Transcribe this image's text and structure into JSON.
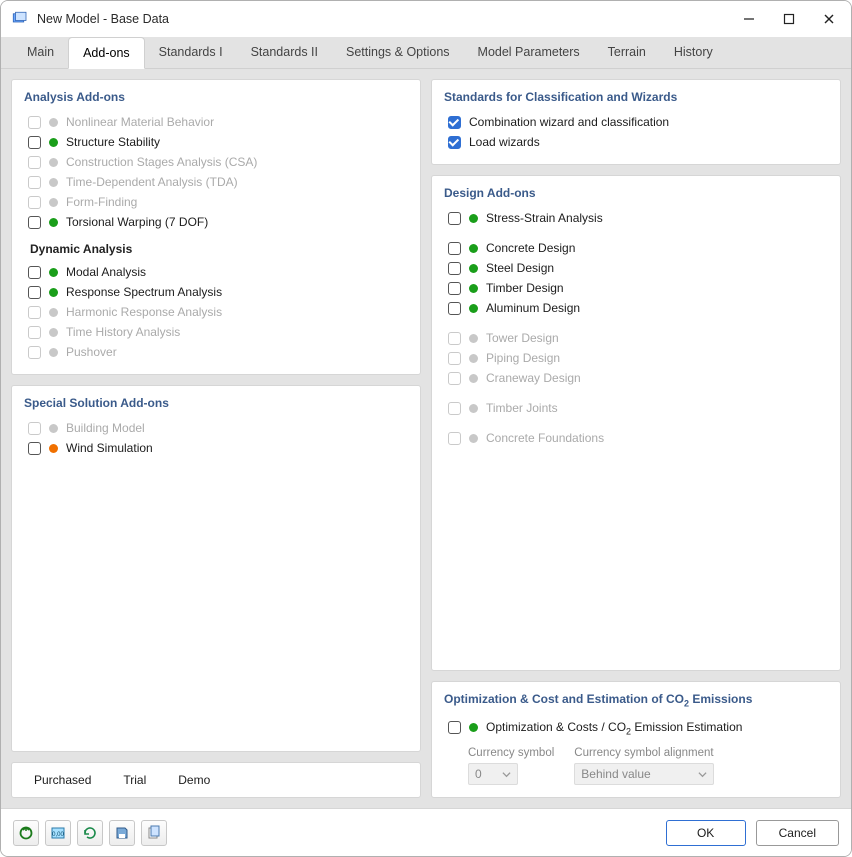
{
  "window": {
    "title": "New Model - Base Data"
  },
  "tabs": {
    "items": [
      {
        "label": "Main"
      },
      {
        "label": "Add-ons"
      },
      {
        "label": "Standards I"
      },
      {
        "label": "Standards II"
      },
      {
        "label": "Settings & Options"
      },
      {
        "label": "Model Parameters"
      },
      {
        "label": "Terrain"
      },
      {
        "label": "History"
      }
    ],
    "active": 1
  },
  "panels": {
    "analysis": {
      "title": "Analysis Add-ons",
      "items": [
        {
          "label": "Nonlinear Material Behavior",
          "dot": "grey",
          "disabled": true
        },
        {
          "label": "Structure Stability",
          "dot": "green"
        },
        {
          "label": "Construction Stages Analysis (CSA)",
          "dot": "grey",
          "disabled": true
        },
        {
          "label": "Time-Dependent Analysis (TDA)",
          "dot": "grey",
          "disabled": true
        },
        {
          "label": "Form-Finding",
          "dot": "grey",
          "disabled": true
        },
        {
          "label": "Torsional Warping (7 DOF)",
          "dot": "green"
        }
      ],
      "sub_title": "Dynamic Analysis",
      "sub_items": [
        {
          "label": "Modal Analysis",
          "dot": "green"
        },
        {
          "label": "Response Spectrum Analysis",
          "dot": "green"
        },
        {
          "label": "Harmonic Response Analysis",
          "dot": "grey",
          "disabled": true
        },
        {
          "label": "Time History Analysis",
          "dot": "grey",
          "disabled": true
        },
        {
          "label": "Pushover",
          "dot": "grey",
          "disabled": true
        }
      ]
    },
    "special": {
      "title": "Special Solution Add-ons",
      "items": [
        {
          "label": "Building Model",
          "dot": "grey",
          "disabled": true
        },
        {
          "label": "Wind Simulation",
          "dot": "orange"
        }
      ]
    },
    "standards": {
      "title": "Standards for Classification and Wizards",
      "items": [
        {
          "label": "Combination wizard and classification",
          "checked": true
        },
        {
          "label": "Load wizards",
          "checked": true
        }
      ]
    },
    "design": {
      "title": "Design Add-ons",
      "g1": [
        {
          "label": "Stress-Strain Analysis",
          "dot": "green"
        }
      ],
      "g2": [
        {
          "label": "Concrete Design",
          "dot": "green"
        },
        {
          "label": "Steel Design",
          "dot": "green"
        },
        {
          "label": "Timber Design",
          "dot": "green"
        },
        {
          "label": "Aluminum Design",
          "dot": "green"
        }
      ],
      "g3": [
        {
          "label": "Tower Design",
          "dot": "grey",
          "disabled": true
        },
        {
          "label": "Piping Design",
          "dot": "grey",
          "disabled": true
        },
        {
          "label": "Craneway Design",
          "dot": "grey",
          "disabled": true
        }
      ],
      "g4": [
        {
          "label": "Timber Joints",
          "dot": "grey",
          "disabled": true
        }
      ],
      "g5": [
        {
          "label": "Concrete Foundations",
          "dot": "grey",
          "disabled": true
        }
      ]
    },
    "opt": {
      "title_html": "Optimization & Cost and Estimation of CO₂ Emissions",
      "item_label": "Optimization & Costs / CO₂ Emission Estimation",
      "currency_label": "Currency symbol",
      "currency_value": "0",
      "align_label": "Currency symbol alignment",
      "align_value": "Behind value"
    }
  },
  "legend": {
    "purchased": "Purchased",
    "trial": "Trial",
    "demo": "Demo"
  },
  "footer": {
    "ok": "OK",
    "cancel": "Cancel"
  }
}
